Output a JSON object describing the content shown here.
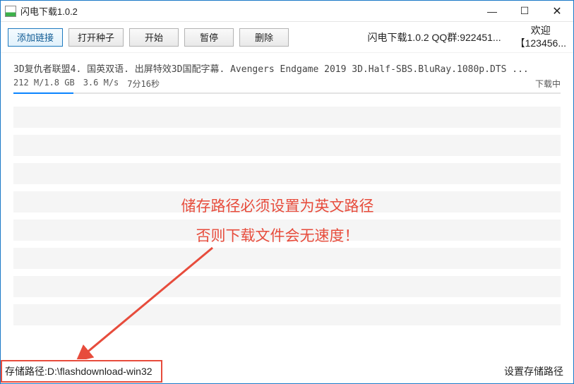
{
  "window": {
    "title": "闪电下载1.0.2"
  },
  "toolbar": {
    "add_link": "添加链接",
    "open_seed": "打开种子",
    "start": "开始",
    "pause": "暂停",
    "delete": "删除",
    "info": "闪电下载1.0.2  QQ群:922451...",
    "welcome1": "欢迎",
    "welcome2": "【123456..."
  },
  "download": {
    "name": "3D复仇者联盟4. 国英双语. 出屏特效3D国配字幕. Avengers Endgame 2019 3D.Half-SBS.BluRay.1080p.DTS ...",
    "size": "212 M/1.8 GB",
    "speed": "3.6 M/s",
    "remaining": "7分16秒",
    "status": "下载中"
  },
  "status": {
    "path_label": "存储路径:",
    "path_value": "D:\\flashdownload-win32",
    "settings": "设置存储路径"
  },
  "annotation": {
    "line1": "储存路径必须设置为英文路径",
    "line2": "否则下载文件会无速度！"
  }
}
